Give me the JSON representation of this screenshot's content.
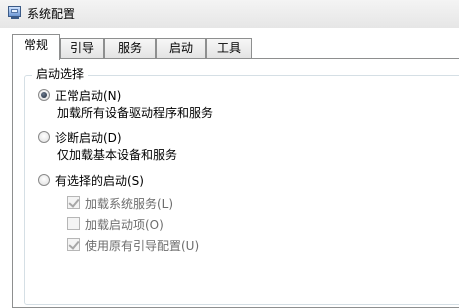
{
  "window": {
    "title": "系统配置",
    "icon": "msconfig-monitor-icon"
  },
  "tabs": [
    {
      "label": "常规",
      "active": true
    },
    {
      "label": "引导",
      "active": false
    },
    {
      "label": "服务",
      "active": false
    },
    {
      "label": "启动",
      "active": false
    },
    {
      "label": "工具",
      "active": false
    }
  ],
  "startup_selection": {
    "group_label": "启动选择",
    "options": [
      {
        "label": "正常启动(N)",
        "description": "加载所有设备驱动程序和服务",
        "selected": true
      },
      {
        "label": "诊断启动(D)",
        "description": "仅加载基本设备和服务",
        "selected": false
      },
      {
        "label": "有选择的启动(S)",
        "selected": false
      }
    ],
    "selective_items": [
      {
        "label": "加载系统服务(L)",
        "checked": true,
        "enabled": false
      },
      {
        "label": "加载启动项(O)",
        "checked": false,
        "enabled": false
      },
      {
        "label": "使用原有引导配置(U)",
        "checked": true,
        "enabled": false
      }
    ]
  }
}
